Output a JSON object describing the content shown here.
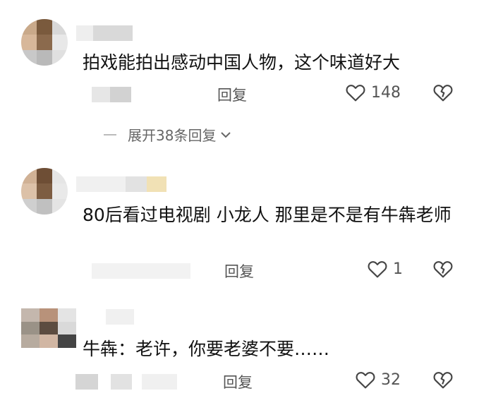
{
  "comments": [
    {
      "text": "拍戏能拍出感动中国人物，这个味道好大",
      "reply_label": "回复",
      "like_count": "148"
    },
    {
      "text": "80后看过电视剧  小龙人 那里是不是有牛犇老师",
      "reply_label": "回复",
      "like_count": "1"
    },
    {
      "text": "牛犇：老许，你要老婆不要……",
      "reply_label": "回复",
      "like_count": "32"
    }
  ],
  "expand_replies": "展开38条回复",
  "icons": {
    "like": "heart-outline-icon",
    "dislike": "broken-heart-icon",
    "expand": "chevron-down-icon"
  },
  "colors": {
    "text": "#111111",
    "meta": "#555555",
    "icon": "#444444"
  }
}
